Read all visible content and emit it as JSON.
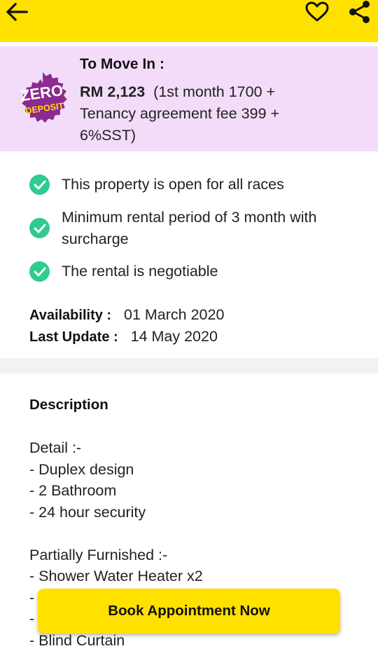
{
  "header": {
    "back_icon": "arrow-left-icon",
    "favorite_icon": "heart-outline-icon",
    "share_icon": "share-icon",
    "bar_color": "#ffe100"
  },
  "move_in": {
    "badge": {
      "line1": "ZERO",
      "line2": "DEPOSIT",
      "color": "#8b2a8f",
      "text_color_line2": "#ffe100"
    },
    "title": "To Move In :",
    "amount": "RM 2,123",
    "breakdown_line1": "(1st month 1700 +",
    "breakdown_line2": "Tenancy agreement fee 399 +",
    "breakdown_line3": "6%SST)",
    "background": "#f3dcfa"
  },
  "features": [
    {
      "text": "This property is open for all races"
    },
    {
      "text": "Minimum rental period of 3 month with surcharge"
    },
    {
      "text": "The rental is negotiable"
    }
  ],
  "availability": {
    "label": "Availability :",
    "value": "01 March 2020"
  },
  "last_update": {
    "label": "Last Update :",
    "value": "14 May 2020"
  },
  "description": {
    "title": "Description",
    "lines": [
      "Detail :-",
      "- Duplex design",
      "- 2 Bathroom",
      "- 24 hour security",
      "",
      "Partially Furnished :-",
      "- Shower Water Heater x2",
      "-",
      "-",
      "- Blind Curtain"
    ]
  },
  "cta": {
    "label": "Book Appointment Now"
  },
  "colors": {
    "accent_yellow": "#ffe100",
    "check_green": "#2ecc8f",
    "divider": "#f2f2f2"
  }
}
